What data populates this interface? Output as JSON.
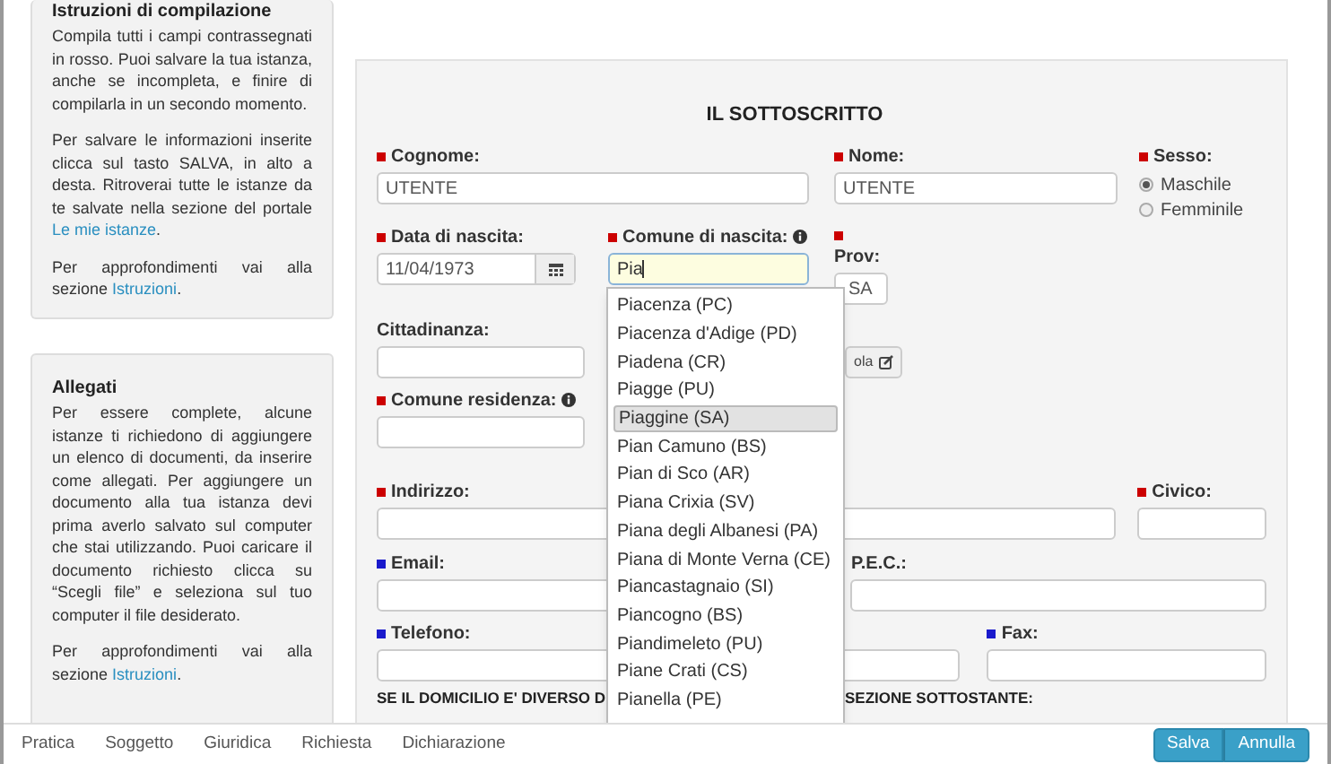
{
  "sidebar": [
    {
      "title": "Istruzioni di compilazione",
      "paragraphs": [
        {
          "text": "Compila tutti i campi contrassegnati in rosso. Puoi salvare la tua istanza, anche se incompleta, e finire di compilarla in un secondo momento."
        },
        {
          "text": "Per salvare le informazioni inserite clicca sul tasto SALVA, in alto a desta. Ritroverai tutte le istanze da te salvate nella sezione del portale",
          "link": "Le mie istanze",
          "after": "."
        },
        {
          "text": "Per approfondimenti vai alla sezione",
          "link": "Istruzioni",
          "after": "."
        }
      ]
    },
    {
      "title": "Allegati",
      "paragraphs": [
        {
          "text": "Per essere complete, alcune istanze ti richiedono di aggiungere un elenco di documenti, da inserire come allegati. Per aggiungere un documento alla tua istanza devi prima averlo salvato sul computer che stai utilizzando. Puoi caricare il documento richiesto clicca su “Scegli file” e seleziona sul tuo computer il file desiderato."
        },
        {
          "text": "Per approfondimenti vai alla sezione",
          "link": "Istruzioni",
          "after": "."
        }
      ]
    }
  ],
  "form": {
    "title": "IL SOTTOSCRITTO",
    "cognome": {
      "label": "Cognome:",
      "color": "#cc0000",
      "value": "UTENTE"
    },
    "nome": {
      "label": "Nome:",
      "color": "#cc0000",
      "value": "UTENTE"
    },
    "sesso": {
      "label": "Sesso:",
      "color": "#cc0000",
      "options": [
        {
          "label": "Maschile",
          "selected": true
        },
        {
          "label": "Femminile",
          "selected": false
        }
      ]
    },
    "data_nascita": {
      "label": "Data di nascita:",
      "color": "#cc0000",
      "value": "11/04/1973"
    },
    "comune_nascita": {
      "label": "Comune di nascita:",
      "color": "#cc0000",
      "info": true,
      "value": "Pia"
    },
    "prov": {
      "label": "Prov:",
      "color": "#cc0000",
      "value": "SA"
    },
    "cittadinanza": {
      "label": "Cittadinanza:"
    },
    "calcola_button": {
      "label": "ola"
    },
    "comune_residenza": {
      "label": "Comune residenza:",
      "color": "#cc0000",
      "info": true
    },
    "indirizzo": {
      "label": "Indirizzo:",
      "color": "#cc0000"
    },
    "civico": {
      "label": "Civico:",
      "color": "#cc0000"
    },
    "email": {
      "label": "Email:",
      "color": "#1a1acc"
    },
    "pec": {
      "label": "P.E.C.:"
    },
    "telefono": {
      "label": "Telefono:",
      "color": "#1a1acc"
    },
    "fax": {
      "label": "Fax:",
      "color": "#1a1acc"
    },
    "domicilio_note": [
      "SE IL DOMICILIO E' DIVERSO D",
      "SEZIONE SOTTOSTANTE:"
    ]
  },
  "autocomplete": [
    {
      "label": "Piacenza (PC)",
      "selected": false
    },
    {
      "label": "Piacenza d'Adige (PD)",
      "selected": false
    },
    {
      "label": "Piadena (CR)",
      "selected": false
    },
    {
      "label": "Piagge (PU)",
      "selected": false
    },
    {
      "label": "Piaggine (SA)",
      "selected": true
    },
    {
      "label": "Pian Camuno (BS)",
      "selected": false
    },
    {
      "label": "Pian di Sco (AR)",
      "selected": false
    },
    {
      "label": "Piana Crixia (SV)",
      "selected": false
    },
    {
      "label": "Piana degli Albanesi (PA)",
      "selected": false
    },
    {
      "label": "Piana di Monte Verna (CE)",
      "selected": false
    },
    {
      "label": "Piancastagnaio (SI)",
      "selected": false
    },
    {
      "label": "Piancogno (BS)",
      "selected": false
    },
    {
      "label": "Piandimeleto (PU)",
      "selected": false
    },
    {
      "label": "Piane Crati (CS)",
      "selected": false
    },
    {
      "label": "Pianella (PE)",
      "selected": false
    }
  ],
  "bottom_tabs": [
    "Pratica",
    "Soggetto",
    "Giuridica",
    "Richiesta",
    "Dichiarazione"
  ],
  "buttons": [
    "Salva",
    "Annulla"
  ]
}
